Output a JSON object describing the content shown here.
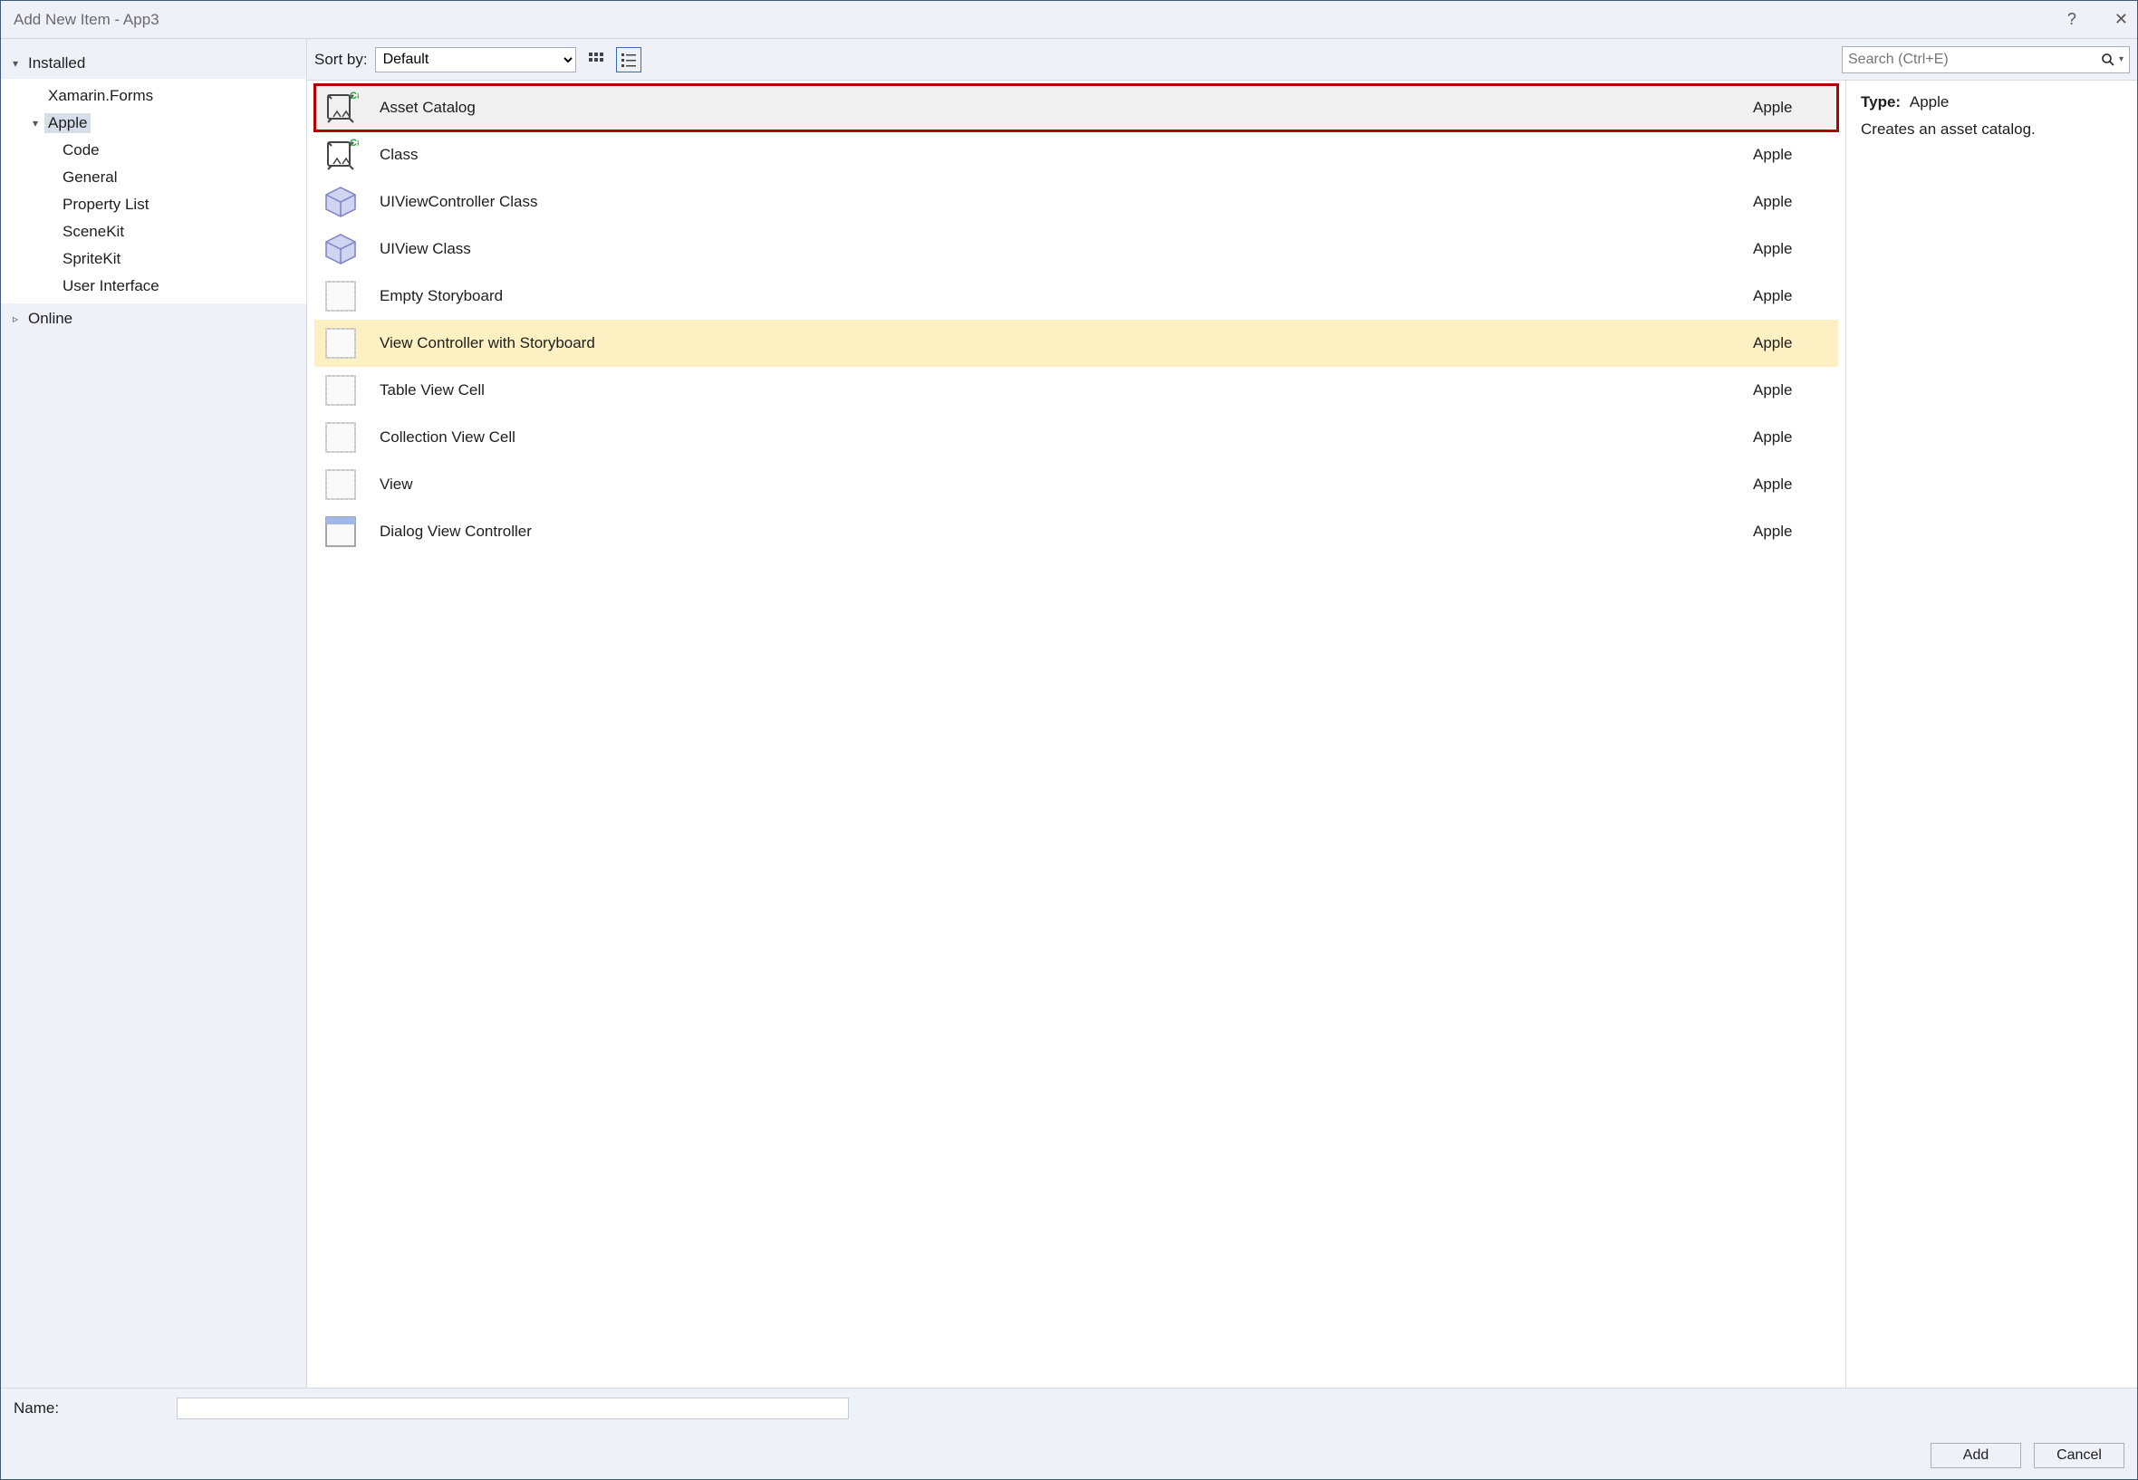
{
  "window_title": "Add New Item - App3",
  "titlebar": {
    "help_glyph": "?",
    "close_glyph": "✕"
  },
  "tree": {
    "installed_label": "Installed",
    "online_label": "Online",
    "items_lvl1": [
      {
        "label": "Xamarin.Forms",
        "selected": false
      },
      {
        "label": "Apple",
        "selected": true
      }
    ],
    "items_lvl2": [
      {
        "label": "Code"
      },
      {
        "label": "General"
      },
      {
        "label": "Property List"
      },
      {
        "label": "SceneKit"
      },
      {
        "label": "SpriteKit"
      },
      {
        "label": "User Interface"
      }
    ]
  },
  "toolbar": {
    "sort_label": "Sort by:",
    "sort_value": "Default",
    "search_placeholder": "Search (Ctrl+E)"
  },
  "templates": [
    {
      "name": "Asset Catalog",
      "tag": "Apple",
      "icon": "csharp-asset",
      "state": "selected"
    },
    {
      "name": "Class",
      "tag": "Apple",
      "icon": "csharp-asset",
      "state": ""
    },
    {
      "name": "UIViewController Class",
      "tag": "Apple",
      "icon": "module-cube",
      "state": ""
    },
    {
      "name": "UIView Class",
      "tag": "Apple",
      "icon": "module-cube",
      "state": ""
    },
    {
      "name": "Empty Storyboard",
      "tag": "Apple",
      "icon": "storyboard",
      "state": ""
    },
    {
      "name": "View Controller with Storyboard",
      "tag": "Apple",
      "icon": "storyboard",
      "state": "hover"
    },
    {
      "name": "Table View Cell",
      "tag": "Apple",
      "icon": "storyboard",
      "state": ""
    },
    {
      "name": "Collection View Cell",
      "tag": "Apple",
      "icon": "storyboard",
      "state": ""
    },
    {
      "name": "View",
      "tag": "Apple",
      "icon": "storyboard",
      "state": ""
    },
    {
      "name": "Dialog View Controller",
      "tag": "Apple",
      "icon": "window",
      "state": ""
    }
  ],
  "details": {
    "type_label": "Type:",
    "type_value": "Apple",
    "description": "Creates an asset catalog."
  },
  "bottom": {
    "name_label": "Name:",
    "name_value": "",
    "add_label": "Add",
    "cancel_label": "Cancel"
  }
}
